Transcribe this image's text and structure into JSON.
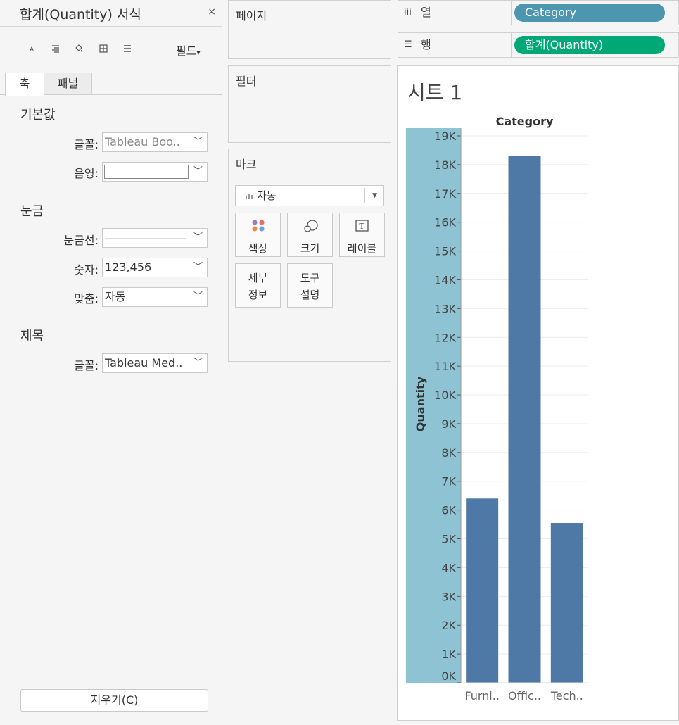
{
  "format_pane": {
    "title": "합계(Quantity) 서식",
    "close": "×",
    "fields_label": "필드",
    "tabs": [
      "축",
      "패널"
    ],
    "section_default": "기본값",
    "font_label": "글꼴:",
    "font_value": "Tableau Boo..",
    "shading_label": "음영:",
    "section_scale": "눈금",
    "tickmarks_label": "눈금선:",
    "numbers_label": "숫자:",
    "numbers_value": "123,456",
    "alignment_label": "맞춤:",
    "alignment_value": "자동",
    "section_title": "제목",
    "title_font_label": "글꼴:",
    "title_font_value": "Tableau Med..",
    "clear_button": "지우기(C)"
  },
  "cards": {
    "pages": "페이지",
    "filters": "필터",
    "marks": "마크",
    "marks_type": "자동",
    "buttons": {
      "color": "색상",
      "size": "크기",
      "label": "레이블",
      "detail": [
        "세부",
        "정보"
      ],
      "tooltip": [
        "도구",
        "설명"
      ]
    }
  },
  "shelves": {
    "columns_label": "열",
    "columns_pill": "Category",
    "rows_label": "행",
    "rows_pill": "합계(Quantity)",
    "columns_color": "#4c96b0",
    "rows_color": "#00a878"
  },
  "sheet": {
    "title": "시트 1"
  },
  "chart_data": {
    "type": "bar",
    "title": "Category",
    "xlabel": "",
    "ylabel": "Quantity",
    "categories": [
      "Furni..",
      "Offic..",
      "Tech.."
    ],
    "values": [
      6400,
      18300,
      5550
    ],
    "ylim": [
      0,
      19000
    ],
    "yticks": [
      "0K",
      "1K",
      "2K",
      "3K",
      "4K",
      "5K",
      "6K",
      "7K",
      "8K",
      "9K",
      "10K",
      "11K",
      "12K",
      "13K",
      "14K",
      "15K",
      "16K",
      "17K",
      "18K",
      "19K"
    ],
    "bar_color": "#4e79a7",
    "axis_highlight_color": "#8ec3d3",
    "grid": true
  }
}
